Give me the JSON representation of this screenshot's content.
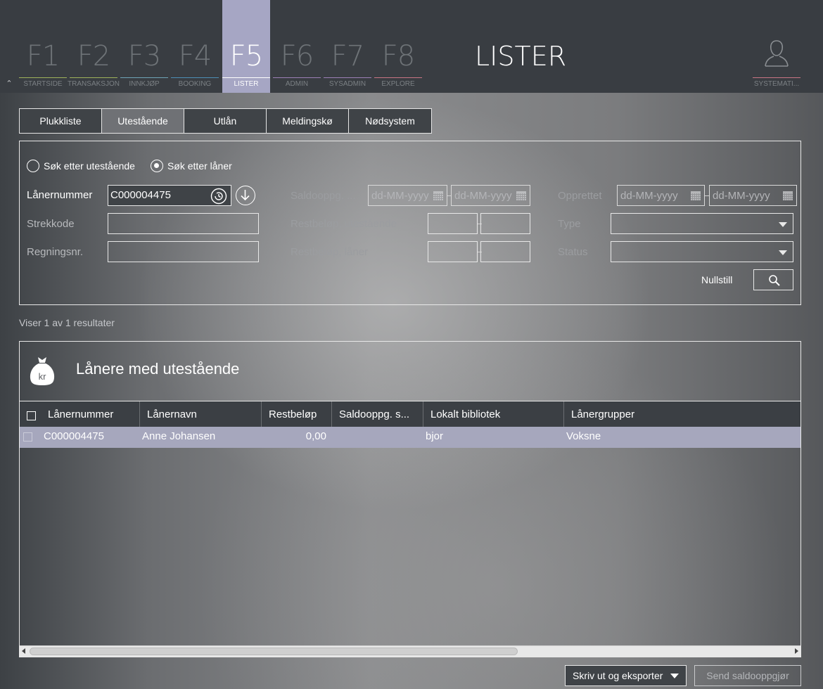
{
  "topbar": {
    "title": "LISTER",
    "fkeys": [
      {
        "key": "F1",
        "label": "STARTSIDE",
        "color": "#9fb25a"
      },
      {
        "key": "F2",
        "label": "TRANSAKSJON",
        "color": "#9fb25a"
      },
      {
        "key": "F3",
        "label": "INNKJØP",
        "color": "#6fa4b7"
      },
      {
        "key": "F4",
        "label": "BOOKING",
        "color": "#4d8fb5"
      },
      {
        "key": "F5",
        "label": "LISTER",
        "color": "#ffffff"
      },
      {
        "key": "F6",
        "label": "ADMIN",
        "color": "#9b7fb5"
      },
      {
        "key": "F7",
        "label": "SYSADMIN",
        "color": "#9b7fb5"
      },
      {
        "key": "F8",
        "label": "EXPLORE",
        "color": "#c97585"
      }
    ],
    "user_label": "SYSTEMATI..."
  },
  "tabs": [
    "Plukkliste",
    "Utestående",
    "Utlån",
    "Meldingskø",
    "Nødsystem"
  ],
  "search": {
    "radio_outstanding": "Søk etter utestående",
    "radio_borrower": "Søk etter låner",
    "borrower_number_label": "Lånernummer",
    "borrower_number_value": "C000004475",
    "barcode_label": "Strekkode",
    "invoice_label": "Regningsnr.",
    "balance_label": "Saldooppg. ...",
    "date_placeholder": "dd-MM-yyyy",
    "rest_outstanding_label": "Restbeløp, utestående",
    "rest_borrower_label": "Restbeløp, låner",
    "created_label": "Opprettet",
    "type_label": "Type",
    "status_label": "Status",
    "reset_label": "Nullstill"
  },
  "results_count": "Viser 1 av 1 resultater",
  "results": {
    "title": "Lånere med utestående",
    "icon_text": "kr",
    "columns": [
      "Lånernummer",
      "Lånernavn",
      "Restbeløp",
      "Saldooppg. s...",
      "Lokalt bibliotek",
      "Lånergrupper"
    ],
    "rows": [
      {
        "number": "C000004475",
        "name": "Anne Johansen",
        "rest": "0,00",
        "balance": "",
        "library": "bjor",
        "groups": "Voksne"
      }
    ]
  },
  "actions": {
    "export_label": "Skriv ut og eksporter",
    "send_label": "Send saldooppgjør"
  }
}
